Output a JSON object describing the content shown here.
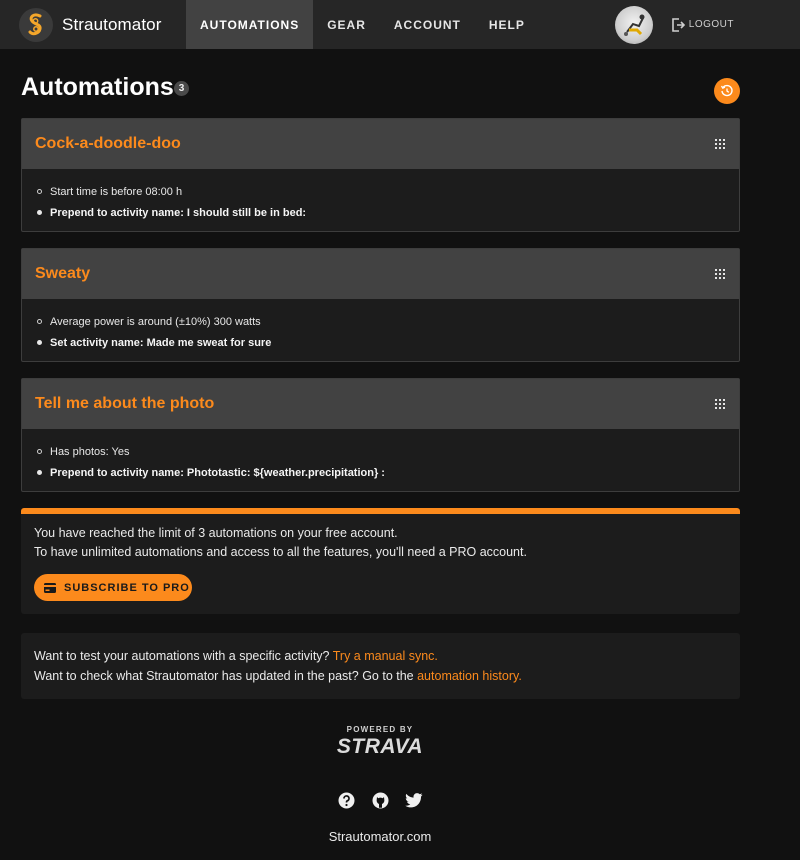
{
  "app": {
    "name": "Strautomator"
  },
  "nav": {
    "items": [
      {
        "label": "AUTOMATIONS",
        "active": true
      },
      {
        "label": "GEAR"
      },
      {
        "label": "ACCOUNT"
      },
      {
        "label": "HELP"
      }
    ],
    "logout_label": "LOGOUT"
  },
  "page": {
    "title": "Automations",
    "count": "3"
  },
  "automations": [
    {
      "name": "Cock-a-doodle-doo",
      "condition": "Start time is before 08:00 h",
      "action": "Prepend to activity name: I should still be in bed:"
    },
    {
      "name": "Sweaty",
      "condition": "Average power is around (±10%) 300 watts",
      "action": "Set activity name: Made me sweat for sure"
    },
    {
      "name": "Tell me about the photo",
      "condition": "Has photos: Yes",
      "action": "Prepend to activity name: Phototastic: ${weather.precipitation} :"
    }
  ],
  "limit": {
    "line1": "You have reached the limit of 3 automations on your free account.",
    "line2": "To have unlimited automations and access to all the features, you'll need a PRO account.",
    "button": "SUBSCRIBE TO PRO"
  },
  "info": {
    "line1_text": "Want to test your automations with a specific activity?",
    "line1_link": "Try a manual sync.",
    "line2_text": "Want to check what Strautomator has updated in the past? Go to the",
    "line2_link": "automation history."
  },
  "footer": {
    "powered_by": "POWERED BY",
    "strava": "STRAVA",
    "site": "Strautomator.com"
  },
  "colors": {
    "accent": "#fc8a1c",
    "background": "#111111",
    "navbar": "#262626"
  }
}
